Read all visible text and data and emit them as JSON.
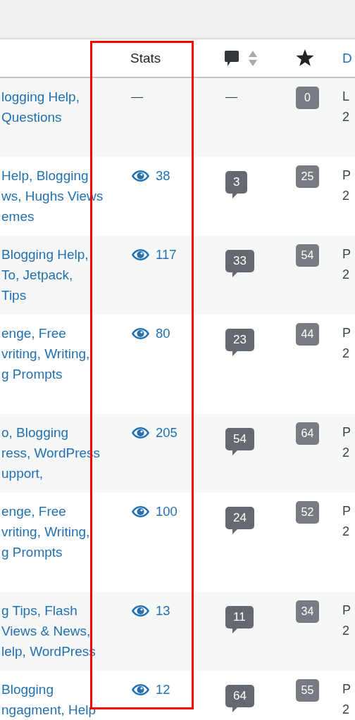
{
  "header": {
    "stats": "Stats",
    "date": "D"
  },
  "rows": [
    {
      "categories": [
        "logging Help,",
        "Questions"
      ],
      "stats": {
        "kind": "dash",
        "text": "—"
      },
      "comments": {
        "kind": "dash",
        "text": "—"
      },
      "likes": "0",
      "date": [
        "L",
        "2"
      ]
    },
    {
      "categories": [
        "Help, Blogging",
        "ws, Hughs Views",
        "emes"
      ],
      "stats": {
        "kind": "views",
        "text": "38"
      },
      "comments": {
        "kind": "count",
        "text": "3"
      },
      "likes": "25",
      "date": [
        "P",
        "2"
      ]
    },
    {
      "categories": [
        "Blogging Help,",
        "To, Jetpack,",
        "Tips"
      ],
      "stats": {
        "kind": "views",
        "text": "117"
      },
      "comments": {
        "kind": "count",
        "text": "33"
      },
      "likes": "54",
      "date": [
        "P",
        "2"
      ]
    },
    {
      "categories": [
        "enge, Free",
        "vriting, Writing,",
        "g Prompts"
      ],
      "stats": {
        "kind": "views",
        "text": "80"
      },
      "comments": {
        "kind": "count",
        "text": "23"
      },
      "likes": "44",
      "date": [
        "P",
        "2"
      ]
    },
    {
      "categories": [
        "o, Blogging",
        "ress, WordPress",
        "upport,"
      ],
      "stats": {
        "kind": "views",
        "text": "205"
      },
      "comments": {
        "kind": "count",
        "text": "54"
      },
      "likes": "64",
      "date": [
        "P",
        "2"
      ]
    },
    {
      "categories": [
        "enge, Free",
        "vriting, Writing,",
        "g Prompts"
      ],
      "stats": {
        "kind": "views",
        "text": "100"
      },
      "comments": {
        "kind": "count",
        "text": "24"
      },
      "likes": "52",
      "date": [
        "P",
        "2"
      ]
    },
    {
      "categories": [
        "g Tips, Flash",
        "Views & News,",
        "lelp, WordPress"
      ],
      "stats": {
        "kind": "views",
        "text": "13"
      },
      "comments": {
        "kind": "count",
        "text": "11"
      },
      "likes": "34",
      "date": [
        "P",
        "2"
      ]
    },
    {
      "categories": [
        "Blogging",
        "ngagment, Help"
      ],
      "stats": {
        "kind": "views",
        "text": "12"
      },
      "comments": {
        "kind": "count",
        "text": "64"
      },
      "likes": "55",
      "date": [
        "P",
        "2"
      ]
    }
  ]
}
